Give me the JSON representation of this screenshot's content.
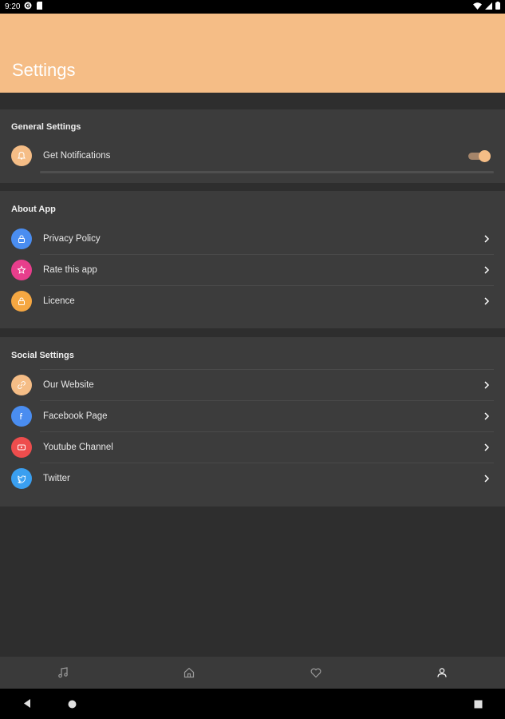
{
  "status_bar": {
    "time": "9:20",
    "icons": [
      "app-icon",
      "sd-card-icon"
    ],
    "right_icons": [
      "wifi-icon",
      "signal-icon",
      "battery-icon"
    ]
  },
  "header": {
    "title": "Settings",
    "background": "#f5bd86"
  },
  "general_settings": {
    "title": "General Settings",
    "items": [
      {
        "label": "Get Notifications",
        "icon": "bell-icon",
        "icon_color": "#f5bd86",
        "toggle_on": true
      }
    ]
  },
  "about_app": {
    "title": "About App",
    "items": [
      {
        "label": "Privacy Policy",
        "icon": "lock-icon",
        "icon_color": "#4a8df0"
      },
      {
        "label": "Rate this app",
        "icon": "star-icon",
        "icon_color": "#e83e8c"
      },
      {
        "label": "Licence",
        "icon": "lock-icon",
        "icon_color": "#f5a742"
      }
    ]
  },
  "social_settings": {
    "title": "Social Settings",
    "items": [
      {
        "label": "Our Website",
        "icon": "link-icon",
        "icon_color": "#f5bd86"
      },
      {
        "label": "Facebook Page",
        "icon": "facebook-icon",
        "icon_color": "#4a8df0"
      },
      {
        "label": "Youtube Channel",
        "icon": "youtube-icon",
        "icon_color": "#ee4d4d"
      },
      {
        "label": "Twitter",
        "icon": "twitter-icon",
        "icon_color": "#3a9ff0"
      }
    ]
  },
  "bottom_nav": {
    "items": [
      "music-icon",
      "home-icon",
      "heart-icon",
      "profile-icon"
    ],
    "active": "profile-icon"
  },
  "system_nav": {
    "buttons": [
      "back-icon",
      "home-circle-icon",
      "recents-icon"
    ]
  }
}
